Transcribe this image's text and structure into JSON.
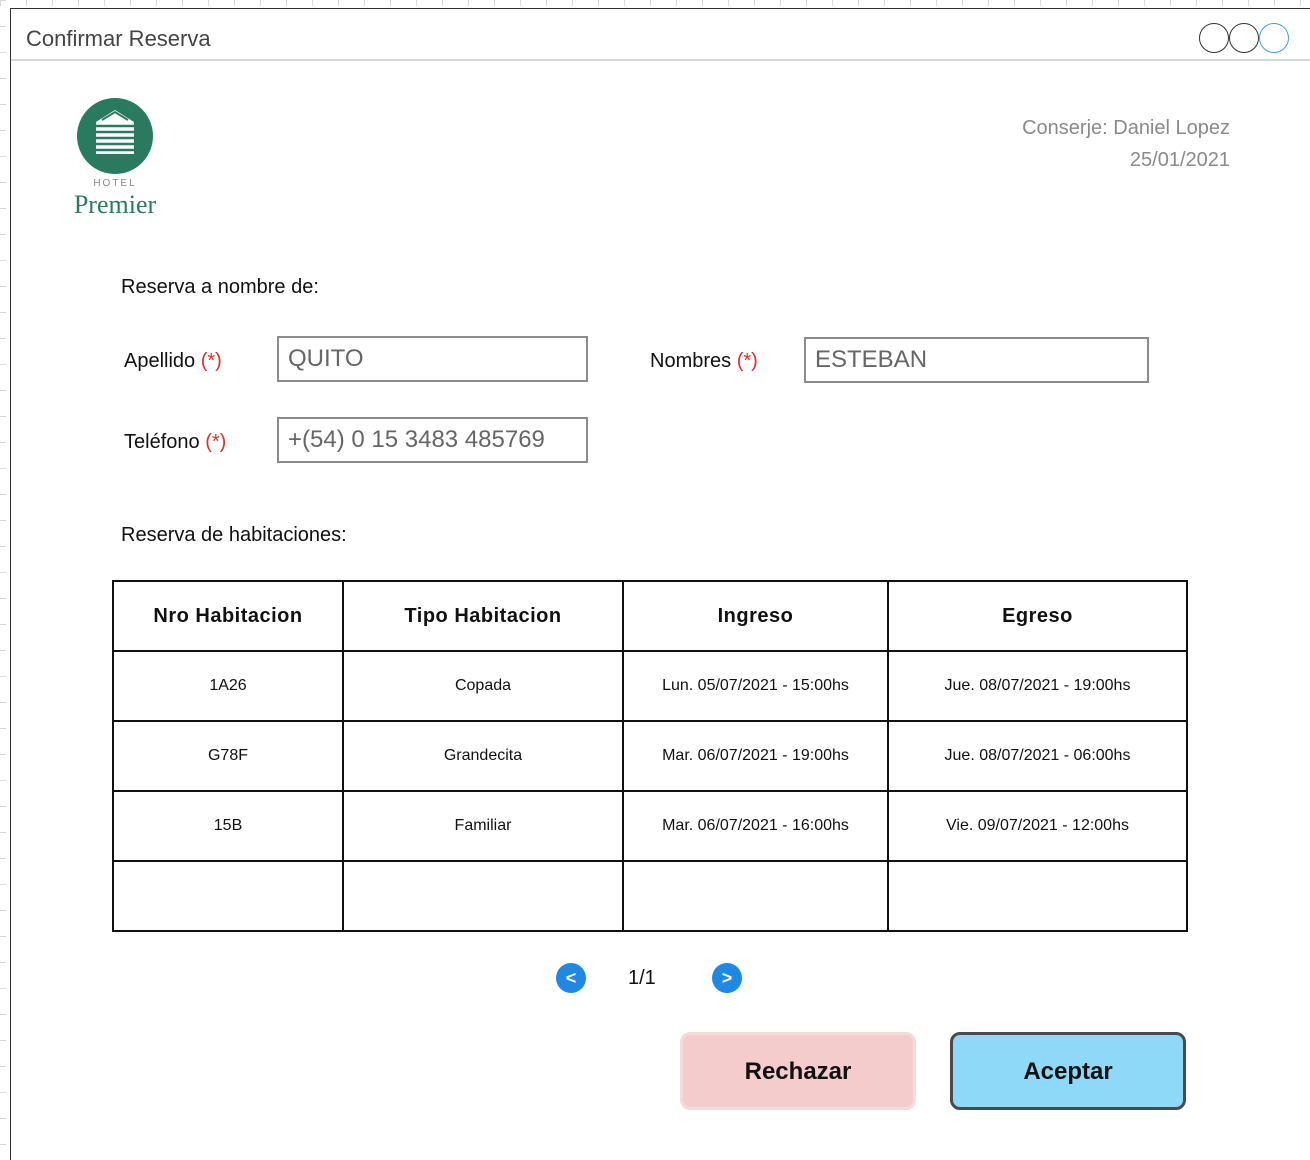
{
  "window": {
    "title": "Confirmar Reserva"
  },
  "logo": {
    "hotel": "HOTEL",
    "name": "Premier",
    "color": "#2a7a60"
  },
  "header": {
    "concierge": "Conserje: Daniel Lopez",
    "date": "25/01/2021"
  },
  "guest_section": {
    "heading": "Reserva a nombre de:",
    "required_marker": "(*)",
    "apellido": {
      "label": "Apellido",
      "value": "QUITO"
    },
    "nombres": {
      "label": "Nombres",
      "value": "ESTEBAN"
    },
    "telefono": {
      "label": "Teléfono",
      "value": "+(54) 0 15 3483 485769"
    }
  },
  "rooms_section": {
    "heading": "Reserva de habitaciones:",
    "columns": [
      "Nro Habitacion",
      "Tipo Habitacion",
      "Ingreso",
      "Egreso"
    ],
    "rows": [
      [
        "1A26",
        "Copada",
        "Lun. 05/07/2021 - 15:00hs",
        "Jue. 08/07/2021 - 19:00hs"
      ],
      [
        "G78F",
        "Grandecita",
        "Mar. 06/07/2021 - 19:00hs",
        "Jue. 08/07/2021 - 06:00hs"
      ],
      [
        "15B",
        "Familiar",
        "Mar. 06/07/2021 - 16:00hs",
        "Vie. 09/07/2021 - 12:00hs"
      ],
      [
        "",
        "",
        "",
        ""
      ]
    ]
  },
  "pagination": {
    "prev_icon": "<",
    "next_icon": ">",
    "page": "1/1"
  },
  "actions": {
    "reject_label": "Rechazar",
    "accept_label": "Aceptar",
    "reject_color": "#f5cccc",
    "accept_color": "#8ed8f8"
  }
}
